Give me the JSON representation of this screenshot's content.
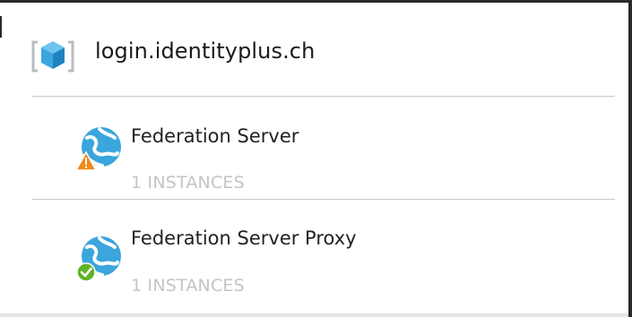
{
  "header": {
    "title": "login.identityplus.ch",
    "icon": "cloud-service-cube-icon"
  },
  "roles": [
    {
      "name": "Federation Server",
      "instances": "1 INSTANCES",
      "icon": "web-role-globe-icon",
      "status": "warning",
      "status_color": "#f08a1c"
    },
    {
      "name": "Federation Server Proxy",
      "instances": "1 INSTANCES",
      "icon": "web-role-globe-icon",
      "status": "healthy",
      "status_color": "#5fb326"
    }
  ],
  "colors": {
    "accent_blue": "#3aa6dd",
    "divider": "#c8c8c8",
    "muted_text": "#c4c4c4"
  }
}
